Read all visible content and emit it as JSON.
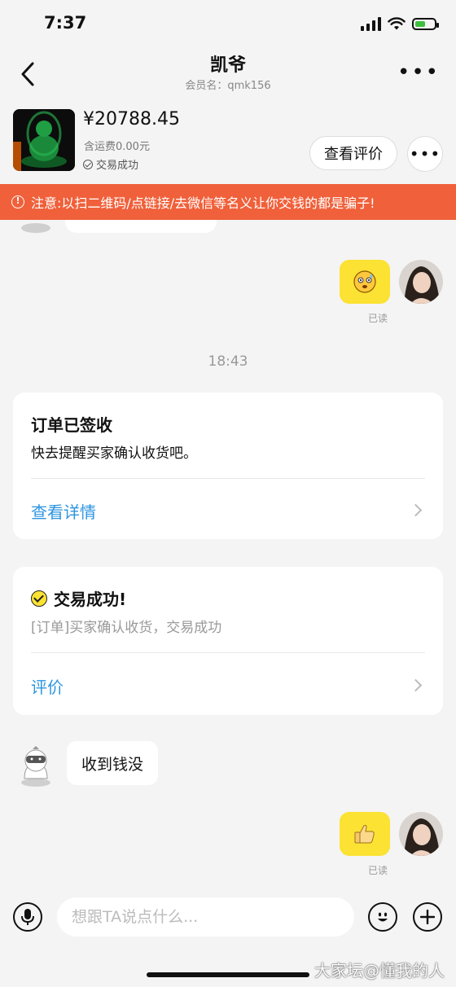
{
  "status_bar": {
    "time": "7:37"
  },
  "header": {
    "title": "凯爷",
    "subtitle": "会员名：qmk156"
  },
  "product": {
    "price": "¥20788.45",
    "shipping": "含运费0.00元",
    "status": "交易成功",
    "review_button": "查看评价",
    "more_button": "•••"
  },
  "warning": {
    "text": "注意:以扫二维码/点链接/去微信等名义让你交钱的都是骗子!"
  },
  "chat": {
    "read_label_1": "已读",
    "timestamp": "18:43",
    "order_card": {
      "title": "订单已签收",
      "subtitle": "快去提醒买家确认收货吧。",
      "link": "查看详情"
    },
    "success_card": {
      "title": "交易成功!",
      "subtitle": "[订单]买家确认收货，交易成功",
      "link": "评价"
    },
    "incoming_message": "收到钱没",
    "read_label_2": "已读"
  },
  "input_bar": {
    "placeholder": "想跟TA说点什么..."
  },
  "watermark": "大家坛@懂我的人"
}
